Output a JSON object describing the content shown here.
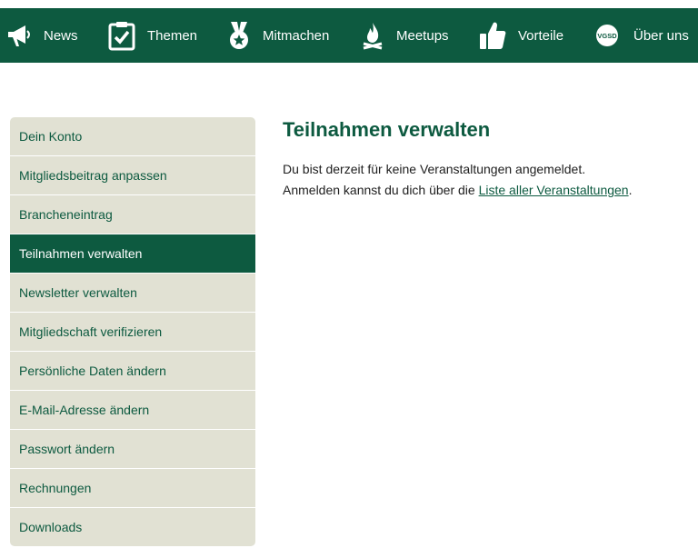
{
  "nav": {
    "items": [
      {
        "label": "News",
        "icon": "megaphone-icon"
      },
      {
        "label": "Themen",
        "icon": "clipboard-check-icon"
      },
      {
        "label": "Mitmachen",
        "icon": "medal-icon"
      },
      {
        "label": "Meetups",
        "icon": "campfire-icon"
      },
      {
        "label": "Vorteile",
        "icon": "thumbs-up-icon"
      },
      {
        "label": "Über uns",
        "icon": "vgsd-logo-icon",
        "logo_text": "VGSD"
      }
    ]
  },
  "sidebar": {
    "active_index": 3,
    "items": [
      "Dein Konto",
      "Mitgliedsbeitrag anpassen",
      "Brancheneintrag",
      "Teilnahmen verwalten",
      "Newsletter verwalten",
      "Mitgliedschaft verifizieren",
      "Persönliche Daten ändern",
      "E-Mail-Adresse ändern",
      "Passwort ändern",
      "Rechnungen",
      "Downloads"
    ]
  },
  "main": {
    "title": "Teilnahmen verwalten",
    "line1": "Du bist derzeit für keine Veranstaltungen angemeldet.",
    "line2_prefix": "Anmelden kannst du dich über die ",
    "line2_link": "Liste aller Veranstaltungen",
    "line2_suffix": "."
  },
  "colors": {
    "brand_green": "#0d5a40",
    "sidebar_bg": "#e1e1d3",
    "text": "#1e1e1e"
  }
}
